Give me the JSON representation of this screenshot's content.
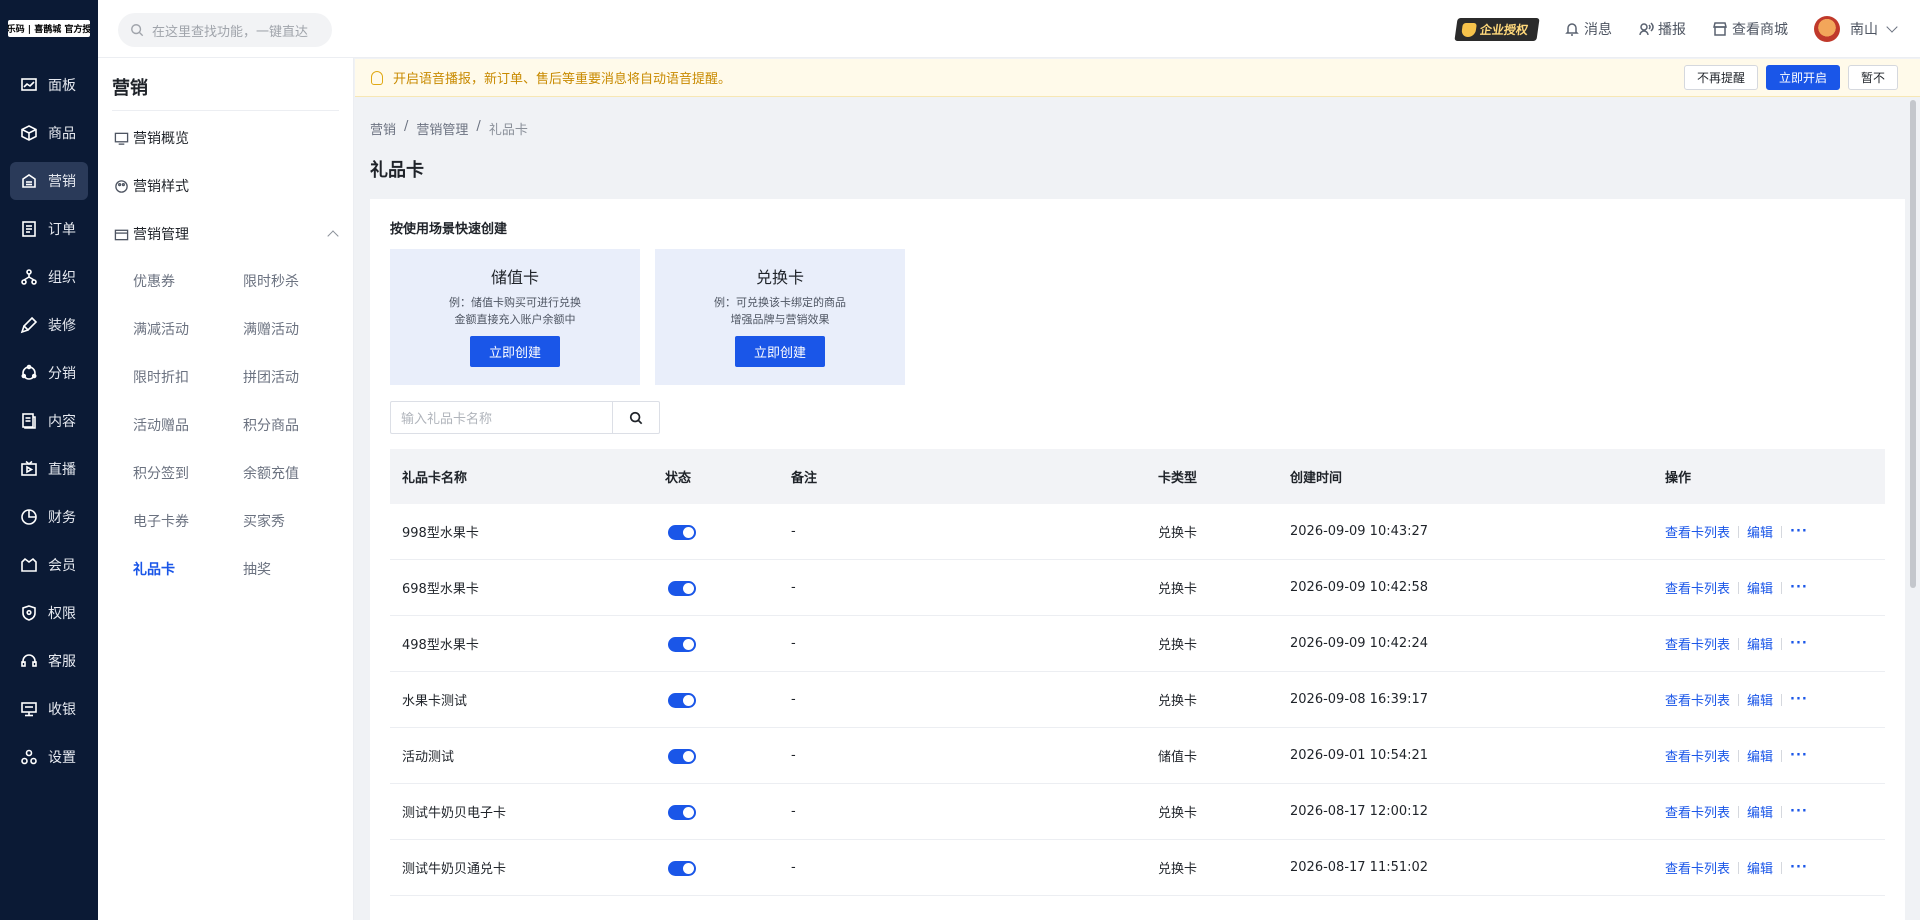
{
  "app": {
    "logo_text": "乐乐码 | 喜鹊城 官方授权"
  },
  "nav": [
    {
      "label": "面板",
      "icon": "dashboard-icon",
      "active": false
    },
    {
      "label": "商品",
      "icon": "box-icon",
      "active": false
    },
    {
      "label": "营销",
      "icon": "marketing-icon",
      "active": true
    },
    {
      "label": "订单",
      "icon": "order-icon",
      "active": false
    },
    {
      "label": "组织",
      "icon": "org-icon",
      "active": false
    },
    {
      "label": "装修",
      "icon": "brush-icon",
      "active": false
    },
    {
      "label": "分销",
      "icon": "distribution-icon",
      "active": false
    },
    {
      "label": "内容",
      "icon": "content-icon",
      "active": false
    },
    {
      "label": "直播",
      "icon": "live-icon",
      "active": false
    },
    {
      "label": "财务",
      "icon": "finance-icon",
      "active": false
    },
    {
      "label": "会员",
      "icon": "member-icon",
      "active": false
    },
    {
      "label": "权限",
      "icon": "shield-icon",
      "active": false
    },
    {
      "label": "客服",
      "icon": "headset-icon",
      "active": false
    },
    {
      "label": "收银",
      "icon": "cashier-icon",
      "active": false
    },
    {
      "label": "设置",
      "icon": "settings-icon",
      "active": false
    }
  ],
  "topbar": {
    "search_placeholder": "在这里查找功能，一键直达",
    "enterprise_badge": "企业授权",
    "messages": "消息",
    "broadcast": "播报",
    "view_store": "查看商城",
    "username": "南山"
  },
  "subnav": {
    "title": "营销",
    "items": [
      "营销概览",
      "营销样式",
      "营销管理"
    ],
    "leaves_left": [
      "优惠券",
      "满减活动",
      "限时折扣",
      "活动赠品",
      "积分签到",
      "电子卡券",
      "礼品卡"
    ],
    "leaves_right": [
      "限时秒杀",
      "满赠活动",
      "拼团活动",
      "积分商品",
      "余额充值",
      "买家秀",
      "抽奖"
    ],
    "active_leaf": "礼品卡"
  },
  "notice": {
    "text": "开启语音播报，新订单、售后等重要消息将自动语音提醒。",
    "dismiss": "不再提醒",
    "enable": "立即开启",
    "later": "暂不"
  },
  "breadcrumb": [
    "营销",
    "营销管理",
    "礼品卡"
  ],
  "page_title": "礼品卡",
  "quick_create": {
    "title": "按使用场景快速创建",
    "cards": [
      {
        "title": "储值卡",
        "desc1": "例：储值卡购买可进行兑换",
        "desc2": "金额直接充入账户余额中",
        "button": "立即创建"
      },
      {
        "title": "兑换卡",
        "desc1": "例：可兑换该卡绑定的商品",
        "desc2": "增强品牌与营销效果",
        "button": "立即创建"
      }
    ]
  },
  "gift_search_placeholder": "输入礼品卡名称",
  "table": {
    "headers": [
      "礼品卡名称",
      "状态",
      "备注",
      "卡类型",
      "创建时间",
      "操作"
    ],
    "op_labels": {
      "view": "查看卡列表",
      "edit": "编辑",
      "more": "···"
    },
    "rows": [
      {
        "name": "998型水果卡",
        "enabled": true,
        "note": "-",
        "type": "兑换卡",
        "created": "2026-09-09 10:43:27"
      },
      {
        "name": "698型水果卡",
        "enabled": true,
        "note": "-",
        "type": "兑换卡",
        "created": "2026-09-09 10:42:58"
      },
      {
        "name": "498型水果卡",
        "enabled": true,
        "note": "-",
        "type": "兑换卡",
        "created": "2026-09-09 10:42:24"
      },
      {
        "name": "水果卡测试",
        "enabled": true,
        "note": "-",
        "type": "兑换卡",
        "created": "2026-09-08 16:39:17"
      },
      {
        "name": "活动测试",
        "enabled": true,
        "note": "-",
        "type": "储值卡",
        "created": "2026-09-01 10:54:21"
      },
      {
        "name": "测试牛奶贝电子卡",
        "enabled": true,
        "note": "-",
        "type": "兑换卡",
        "created": "2026-08-17 12:00:12"
      },
      {
        "name": "测试牛奶贝通兑卡",
        "enabled": true,
        "note": "-",
        "type": "兑换卡",
        "created": "2026-08-17 11:51:02"
      }
    ]
  }
}
